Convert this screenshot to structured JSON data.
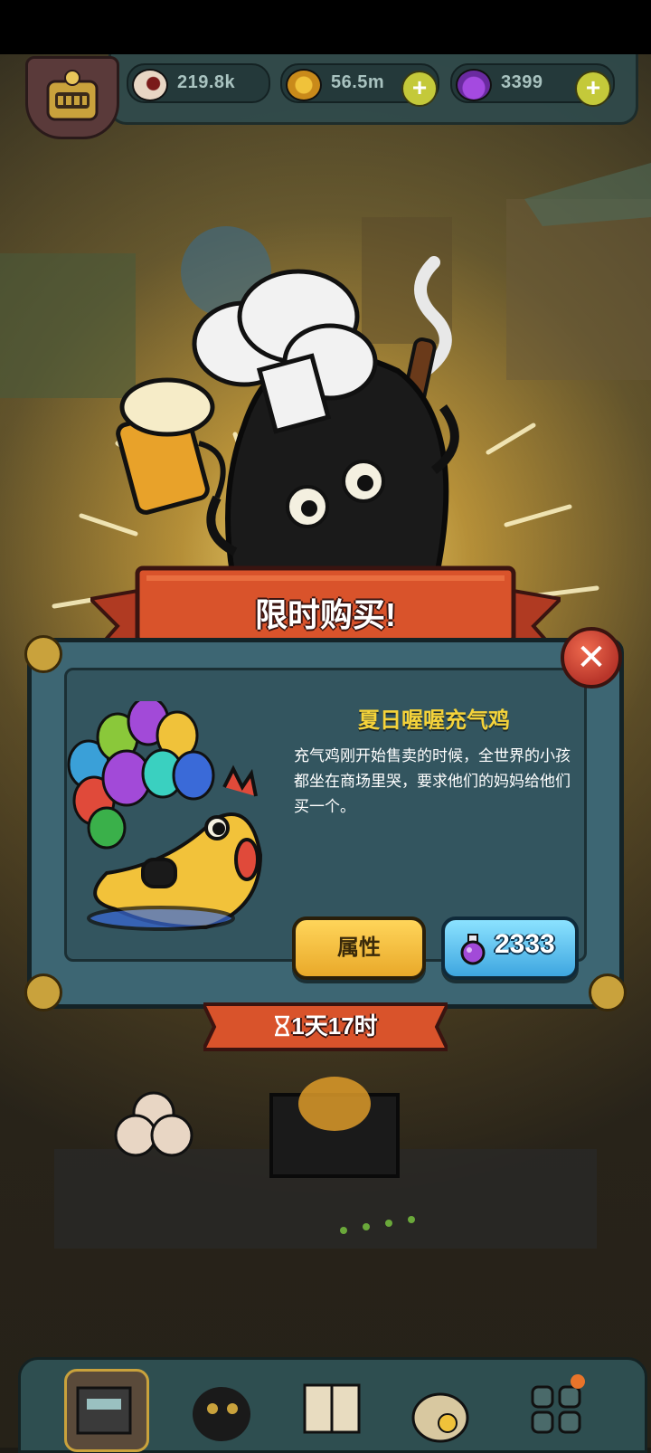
{
  "resources": {
    "eyeballs": "219.8k",
    "coins": "56.5m",
    "potions": "3399",
    "plus_symbol": "+"
  },
  "offer": {
    "banner_title": "限时购买!",
    "item_name": "夏日喔喔充气鸡",
    "item_description": "充气鸡刚开始售卖的时候，全世界的小孩都坐在商场里哭，要求他们的妈妈给他们买一个。",
    "attributes_button": "属性",
    "price": "2333",
    "timer": "1天17时",
    "close_symbol": "✕"
  },
  "icons": {
    "eyeball": "eyeball-icon",
    "coin": "coin-icon",
    "potion": "potion-icon",
    "hourglass": "hourglass-icon",
    "close": "close-icon"
  },
  "colors": {
    "title_yellow": "#f5d33a",
    "ribbon_red": "#d9532b",
    "panel_teal": "#3d6673",
    "buy_blue": "#3ea6e0",
    "attr_yellow": "#e9a92a"
  },
  "nav": {
    "items": [
      "building",
      "monsters",
      "book",
      "bag",
      "grid-menu"
    ]
  }
}
